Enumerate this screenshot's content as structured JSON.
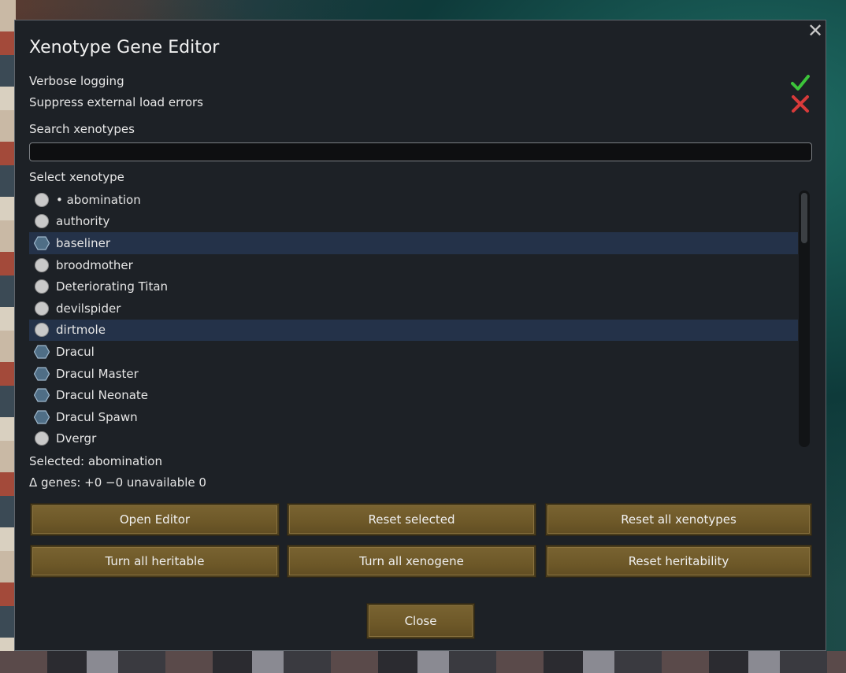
{
  "dialog": {
    "title": "Xenotype Gene Editor",
    "close_glyph": "✕"
  },
  "settings": [
    {
      "label": "Verbose logging",
      "state": "enabled",
      "icon": "check-icon",
      "color": "#3cc43a"
    },
    {
      "label": "Suppress external load errors",
      "state": "disabled",
      "icon": "cross-icon",
      "color": "#d83a3a"
    }
  ],
  "search": {
    "label": "Search xenotypes",
    "value": "",
    "placeholder": ""
  },
  "select_label": "Select xenotype",
  "xenotypes": [
    {
      "label": "• abomination",
      "icon": "circle-icon",
      "highlighted": false
    },
    {
      "label": "authority",
      "icon": "circle-icon",
      "highlighted": false
    },
    {
      "label": "baseliner",
      "icon": "hexagon-icon",
      "highlighted": true
    },
    {
      "label": "broodmother",
      "icon": "circle-icon",
      "highlighted": false
    },
    {
      "label": "Deteriorating Titan",
      "icon": "circle-icon",
      "highlighted": false
    },
    {
      "label": "devilspider",
      "icon": "circle-icon",
      "highlighted": false
    },
    {
      "label": "dirtmole",
      "icon": "circle-icon",
      "highlighted": true
    },
    {
      "label": "Dracul",
      "icon": "hexagon-icon",
      "highlighted": false
    },
    {
      "label": "Dracul Master",
      "icon": "hexagon-icon",
      "highlighted": false
    },
    {
      "label": "Dracul Neonate",
      "icon": "hexagon-icon",
      "highlighted": false
    },
    {
      "label": "Dracul Spawn",
      "icon": "hexagon-icon",
      "highlighted": false
    },
    {
      "label": "Dvergr",
      "icon": "circle-icon",
      "highlighted": false
    }
  ],
  "status": {
    "selected": "Selected: abomination",
    "delta": "Δ genes: +0 −0 unavailable 0"
  },
  "buttons": {
    "open_editor": "Open Editor",
    "reset_selected": "Reset selected",
    "reset_all": "Reset all xenotypes",
    "turn_heritable": "Turn all heritable",
    "turn_xenogene": "Turn all xenogene",
    "reset_heritability": "Reset heritability",
    "close": "Close"
  },
  "colors": {
    "accent_button": "#6d5828",
    "highlight_row": "#243249",
    "panel_bg": "#1d2126"
  }
}
